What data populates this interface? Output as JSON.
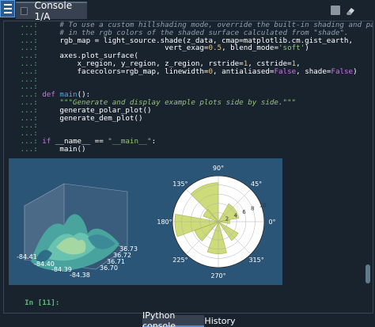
{
  "tabbar": {
    "console_tab_label": "Console 1/A",
    "stop_icon": "stop-square-icon",
    "eraser_icon": "eraser-icon",
    "menu_icon": "hamburger-menu-icon"
  },
  "console": {
    "lines": [
      {
        "p": "...: ",
        "t": "    # To use a custom hillshading mode, override the built-in shading and pass",
        "c": "cm"
      },
      {
        "p": "...: ",
        "t": "    # in the rgb colors of the shaded surface calculated from \"shade\".",
        "c": "cm"
      },
      {
        "p": "...: ",
        "t": "    rgb_map = light_source.shade(z_data, cmap=matplotlib.cm.gist_earth,",
        "c": ""
      },
      {
        "p": "...: ",
        "t": "                            vert_exag=0.5, blend_mode='soft')",
        "c": ""
      },
      {
        "p": "...: ",
        "t": "    axes.plot_surface(",
        "c": ""
      },
      {
        "p": "...: ",
        "t": "        x_region, y_region, z_region, rstride=1, cstride=1,",
        "c": ""
      },
      {
        "p": "...: ",
        "t": "        facecolors=rgb_map, linewidth=0, antialiased=False, shade=False)",
        "c": ""
      },
      {
        "p": "...: ",
        "t": "",
        "c": ""
      },
      {
        "p": "...: ",
        "t": "",
        "c": ""
      },
      {
        "p": "...: ",
        "t": "def main():",
        "c": "def"
      },
      {
        "p": "...: ",
        "t": "    \"\"\"Generate and display example plots side by side.\"\"\"",
        "c": "dstr"
      },
      {
        "p": "...: ",
        "t": "    generate_polar_plot()",
        "c": ""
      },
      {
        "p": "...: ",
        "t": "    generate_dem_plot()",
        "c": ""
      },
      {
        "p": "...: ",
        "t": "",
        "c": ""
      },
      {
        "p": "...: ",
        "t": "",
        "c": ""
      },
      {
        "p": "...: ",
        "t": "if __name__ == \"__main__\":",
        "c": "if"
      },
      {
        "p": "...: ",
        "t": "    main()",
        "c": ""
      }
    ],
    "next_prompt": "In [11]:"
  },
  "figure": {
    "surface_x_ticks": [
      "-84.41",
      "-84.40",
      "-84.39",
      "-84.38"
    ],
    "surface_y_ticks": [
      "36.73",
      "36.72",
      "36.71",
      "36.70"
    ],
    "polar_angle_labels": [
      "90°",
      "45°",
      "0°",
      "315°",
      "270°",
      "225°",
      "180°",
      "135°"
    ],
    "polar_radial_labels": [
      "2",
      "4",
      "6",
      "8",
      "10"
    ],
    "colors": {
      "background": "#2a5577",
      "bar_fill": "#c8d96a"
    }
  },
  "bottom_tabs": {
    "ipython_label": "IPython console",
    "history_label": "History"
  }
}
